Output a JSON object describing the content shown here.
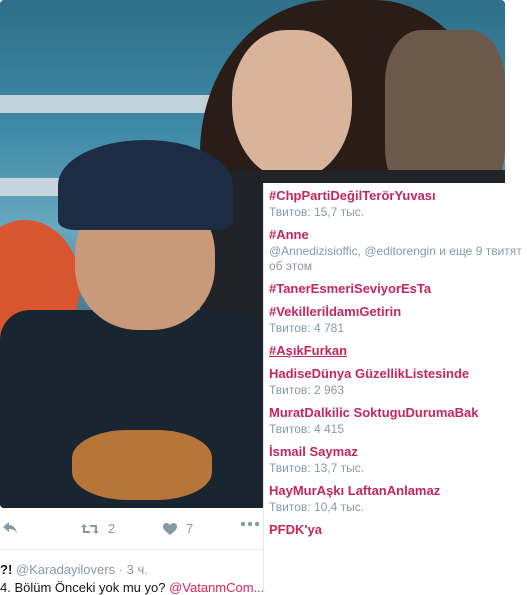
{
  "tweet": {
    "actions": {
      "retweets": "2",
      "likes": "7"
    },
    "next_tweet": {
      "prefix": "?!",
      "handle": "@Karadayilovers",
      "time": "3 ч.",
      "text_start": "4. Bölüm Önceki yok mu yo?",
      "link": "@VatanmCom..."
    },
    "icons": [
      "reply-icon",
      "retweet-icon",
      "heart-icon",
      "more-icon"
    ]
  },
  "trends": [
    {
      "name": "#ChpPartiDeğilTerörYuvası",
      "meta": "Твитов: 15,7 тыс."
    },
    {
      "name": "#Anne",
      "meta": "@Annedizisioffic, @editorengin и еще 9 твитят об этом"
    },
    {
      "name": "#TanerEsmeriSeviyorEsTa",
      "meta": ""
    },
    {
      "name": "#VekilleriİdamıGetirin",
      "meta": "Твитов: 4 781"
    },
    {
      "name": "#AşıkFurkan",
      "meta": "",
      "hovered": true
    },
    {
      "name": "HadiseDünya GüzellikListesinde",
      "meta": "Твитов: 2 963"
    },
    {
      "name": "MuratDalkilic SoktuguDurumaBak",
      "meta": "Твитов: 4 415"
    },
    {
      "name": "İsmail Saymaz",
      "meta": "Твитов: 13,7 тыс."
    },
    {
      "name": "HayMurAşkı LaftanAnlamaz",
      "meta": "Твитов: 10,4 тыс."
    },
    {
      "name": "PFDK'ya",
      "meta": ""
    }
  ],
  "colors": {
    "trend": "#c6265a",
    "meta": "#8899a6"
  }
}
